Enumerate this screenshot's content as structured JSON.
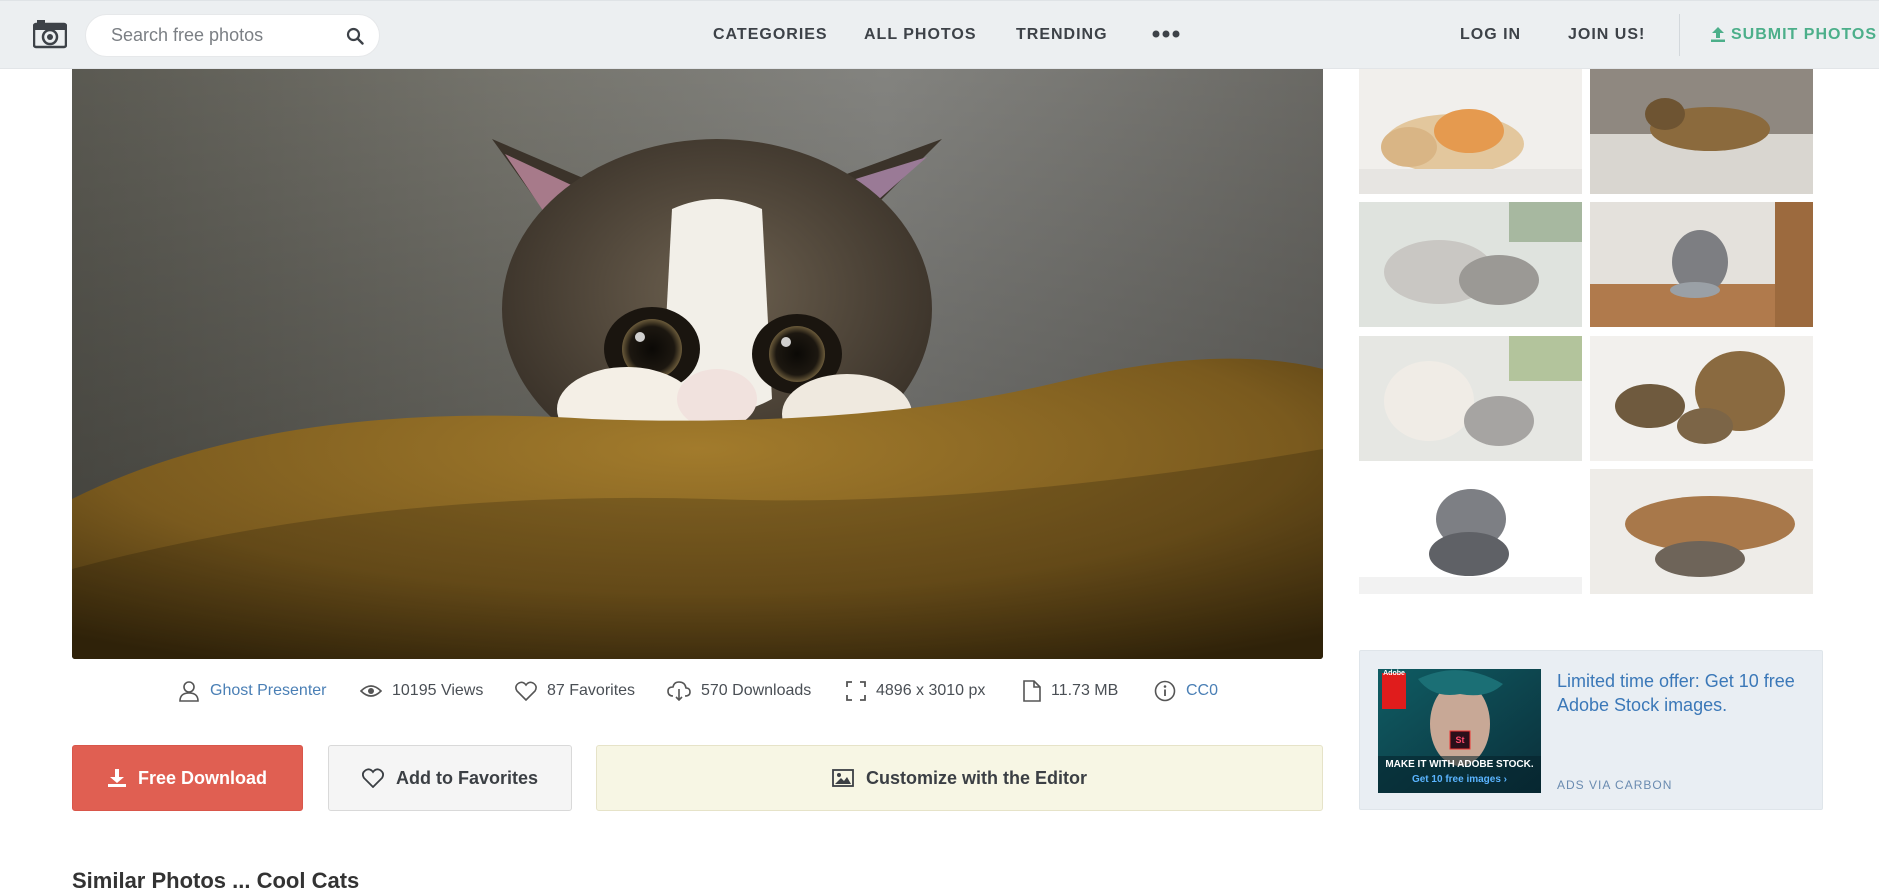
{
  "header": {
    "search_placeholder": "Search free photos",
    "nav": {
      "categories": "CATEGORIES",
      "all_photos": "ALL PHOTOS",
      "trending": "TRENDING",
      "log_in": "LOG IN",
      "join_us": "JOIN US!",
      "submit_photos": "SUBMIT PHOTOS"
    }
  },
  "photo_meta": {
    "author": "Ghost Presenter",
    "views": "10195 Views",
    "favorites": "87 Favorites",
    "downloads": "570 Downloads",
    "dimensions": "4896 x 3010 px",
    "file_size": "11.73 MB",
    "license": "CC0"
  },
  "actions": {
    "download_label": "Free Download",
    "favorite_label": "Add to Favorites",
    "editor_label": "Customize with the Editor"
  },
  "similar_heading": "Similar Photos ... Cool Cats",
  "ad": {
    "text": "Limited time offer: Get 10 free Adobe Stock images.",
    "via": "ADS VIA CARBON",
    "image_caption_main": "MAKE IT WITH ADOBE STOCK.",
    "image_caption_sub": "Get 10 free images ›",
    "brand": "Adobe",
    "badge": "St"
  },
  "colors": {
    "download_button": "#e05f52",
    "submit_accent": "#4caf8a",
    "link": "#4a7fb5",
    "editor_button_bg": "#f7f6e4"
  }
}
